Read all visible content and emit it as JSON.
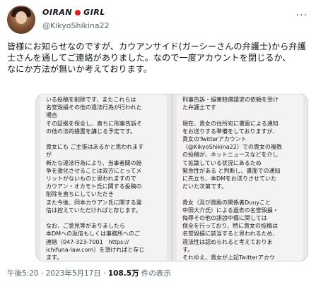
{
  "author": {
    "display_name": "OIRAN",
    "display_name_suffix": "GIRL",
    "handle": "@KikyoShikina22"
  },
  "more_label": "···",
  "tweet": {
    "text": "皆様にお知らせなのですが、カウアンサイド(ガーシーさんの弁護士)から弁護士さんを通してご連絡がありました。なので一度アカウントを閉じるか、\nなにか方法が無いか考えております。"
  },
  "media": [
    {
      "text": "いる投稿を削除です、またこれらは\n名誉毀損その他の違法行為が行われた\n場合\nその証拠を保全し、直ちに刑事告訴そ\nの他の法的措置を講じる予定です。\n\n貴女にも ご主張はあるかと思われます\nが\n新たな違法行為により、当事者間の紛\n争を激化させることは双方にとってメ\nリットがないものと思われますので\nカウアン・オカモト氏に関する投稿の\n削除を直ちにしていただき\nまた今後、同本カウアン氏に関する発\n信は控えていただければと存じます。\n\nなお、ご意見等がありましたら\n本DMへの返信もしくは事務所へのご\n連絡（047-323-7001　https://\nichifuna-law.com）を頂ければと存じ\nます。"
    },
    {
      "text": "刑事告訴・損害賠償請求の依頼を受け\nた弁護士です\n\n現在、貴女の住所宛に書面による通知\nをお送りする準備をしておりますが、\n貴女のTwitterアカウント\n（@KikyoShikina22）での貴女の複数\nの投稿が、ネットニュースなどを介し\nて拡散している状況にあるため\n緊急性がある と判断し、書面での通知\nに先立ち、本DMをお送りさせていた\nだいた次第です。\n\n貴女（及び貴殿の関係者Duuyこと\n中田大介氏）による過去の名誉毀損・\n侮辱その他の誹謗中傷に関しては\n保全を行っており、特に貴女の投稿は\n名誉毀損に該当すると思われるため、\n違法性は認められると考えておりま\nす。\nそれゆえ、貴女が上記Twitterアカウ"
    }
  ],
  "meta": {
    "timestamp": "午後5:20 · 2023年5月17日 · ",
    "views_count": "108.5万",
    "views_label": " 件の表示"
  },
  "colors": {
    "flag_red": "#e0201a",
    "text": "#0f1419",
    "muted": "#536471"
  },
  "icons": {
    "avatar": "avatar-image",
    "flag": "japan-flag-icon",
    "more": "more-icon"
  }
}
